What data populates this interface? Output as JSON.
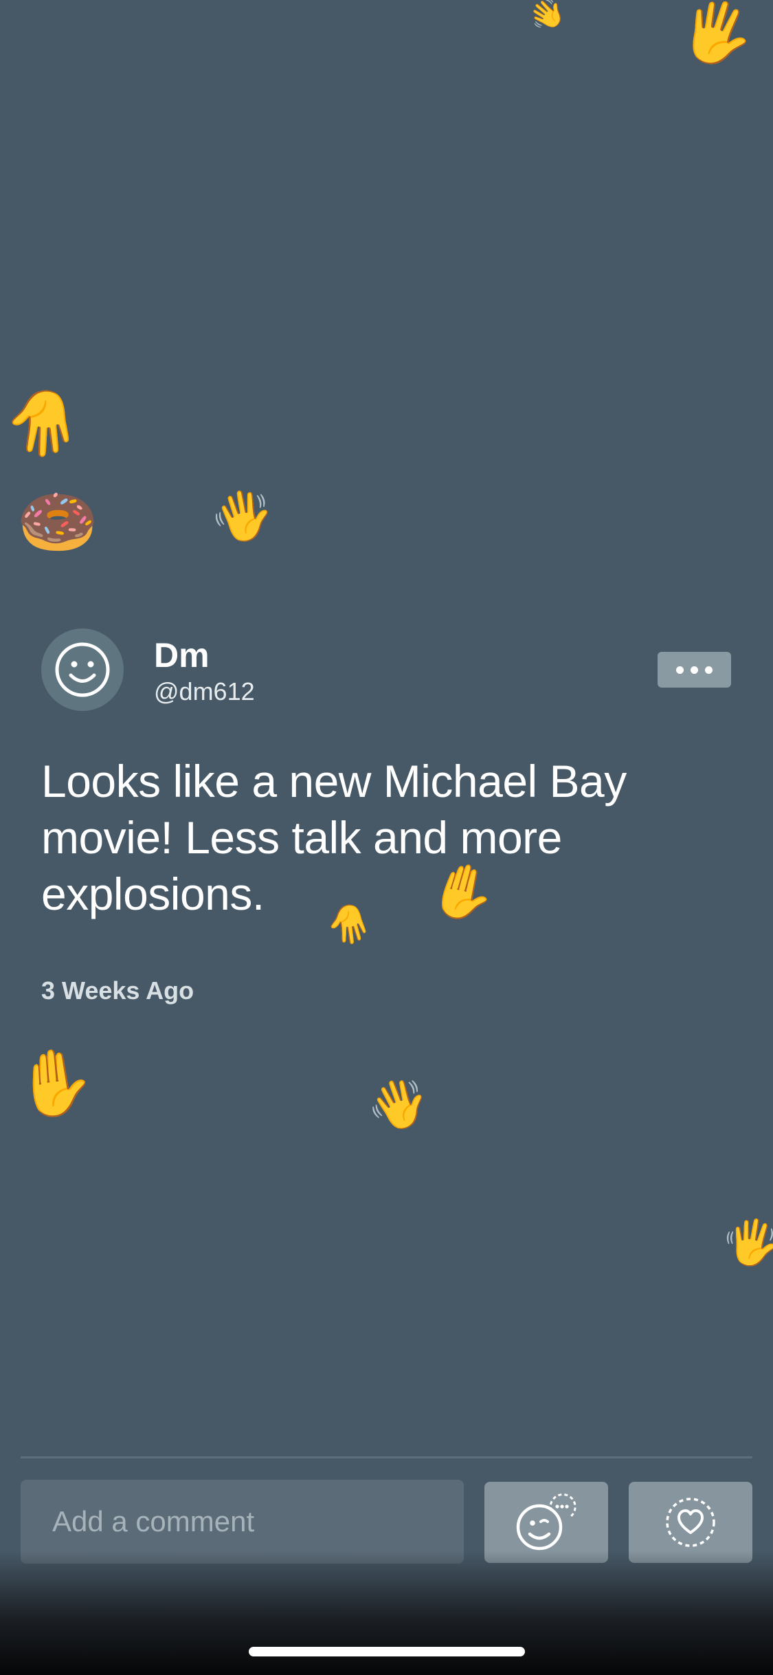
{
  "post": {
    "display_name": "Dm",
    "handle": "@dm612",
    "body": "Looks like a new Michael Bay movie! Less talk and more explosions.",
    "timestamp": "3 Weeks Ago"
  },
  "comment": {
    "placeholder": "Add a comment"
  },
  "icons": {
    "avatar": "smiley-face-icon",
    "more": "ellipsis-icon",
    "reaction": "emoji-react-icon",
    "like": "heart-icon"
  },
  "floaters": {
    "wave": "👋",
    "raised_hand": "🖐",
    "hand": "✋",
    "donut": "🍩"
  },
  "colors": {
    "background": "#475967",
    "button": "#86959e",
    "comment_field": "#5b6b77"
  }
}
